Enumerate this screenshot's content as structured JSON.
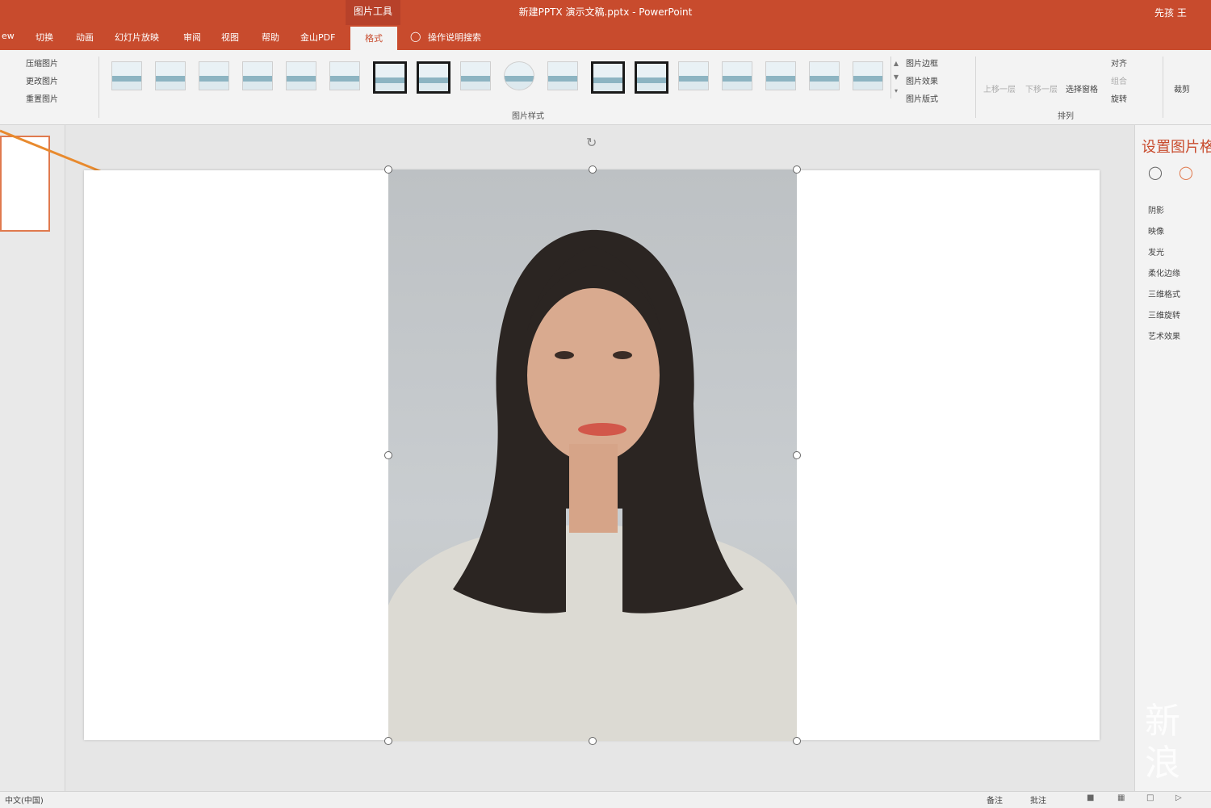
{
  "titlebar": {
    "context_label": "图片工具",
    "document_title": "新建PPTX 演示文稿.pptx - PowerPoint",
    "user": "先孩 王"
  },
  "tabs": [
    "ew",
    "切换",
    "动画",
    "幻灯片放映",
    "审阅",
    "视图",
    "帮助",
    "金山PDF"
  ],
  "active_tab": "格式",
  "tell_me": "操作说明搜索",
  "ribbon": {
    "adjust_cmds": [
      "压缩图片",
      "更改图片",
      "重置图片"
    ],
    "picture_style_count": 18,
    "picture_styles_label": "图片样式",
    "style_cmds": [
      "图片边框",
      "图片效果",
      "图片版式"
    ],
    "arrange_cmds": [
      "上移一层",
      "下移一层",
      "选择窗格"
    ],
    "arrange_small": [
      "对齐",
      "组合",
      "旋转"
    ],
    "arrange_label": "排列",
    "size_cmd": "裁剪"
  },
  "right_pane": {
    "title": "设置图片格",
    "items": [
      "阴影",
      "映像",
      "发光",
      "柔化边缘",
      "三维格式",
      "三维旋转",
      "艺术效果"
    ]
  },
  "statusbar": {
    "language": "中文(中国)",
    "notes": "备注",
    "comments": "批注"
  },
  "watermark": "新浪",
  "colors": {
    "accent": "#c84b2d",
    "selected_thumb_border": "#e07a4e"
  }
}
